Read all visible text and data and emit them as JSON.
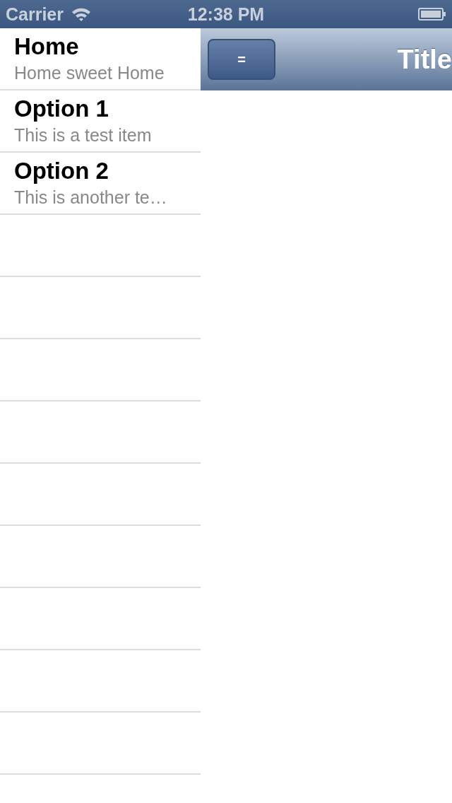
{
  "status_bar": {
    "carrier": "Carrier",
    "time": "12:38 PM"
  },
  "menu": {
    "items": [
      {
        "title": "Home",
        "subtitle": "Home sweet Home"
      },
      {
        "title": "Option 1",
        "subtitle": "This is a test item"
      },
      {
        "title": "Option 2",
        "subtitle": "This is another te…"
      }
    ]
  },
  "nav_bar": {
    "button": "=",
    "title": "Title"
  }
}
